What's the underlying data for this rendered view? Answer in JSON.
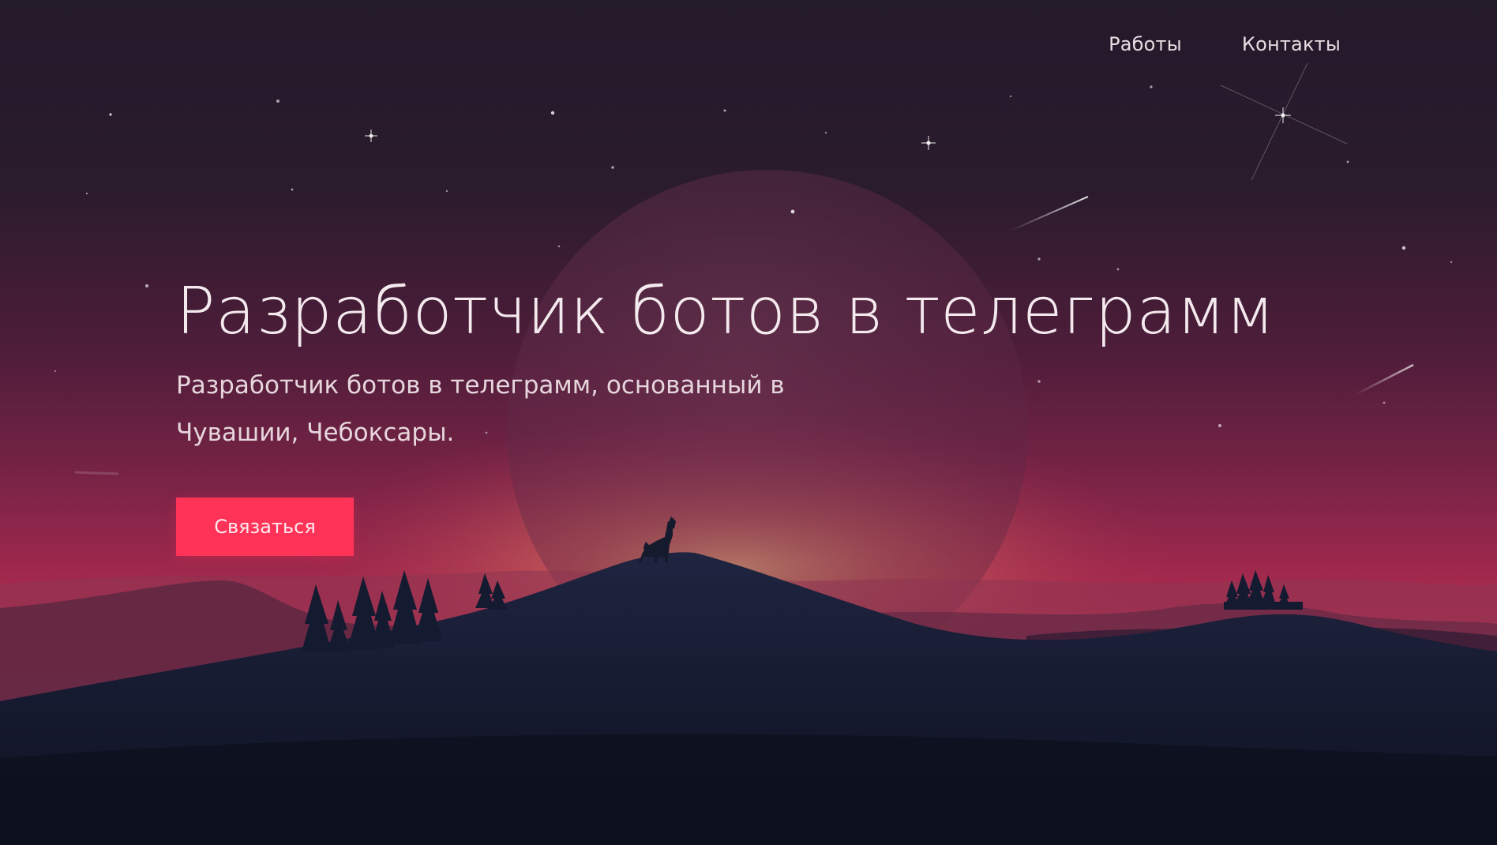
{
  "nav": {
    "items": [
      {
        "label": "Работы"
      },
      {
        "label": "Контакты"
      }
    ]
  },
  "hero": {
    "title": "Разработчик ботов в телеграмм",
    "subtitle": "Разработчик ботов в телеграмм, основанный в Чувашии, Чебоксары.",
    "cta_label": "Связаться"
  },
  "colors": {
    "accent": "#ff3358",
    "sky_top": "#231a2a",
    "sky_mid": "#6b2244",
    "sky_glow": "#d88a6a",
    "ground": "#0e1120"
  }
}
